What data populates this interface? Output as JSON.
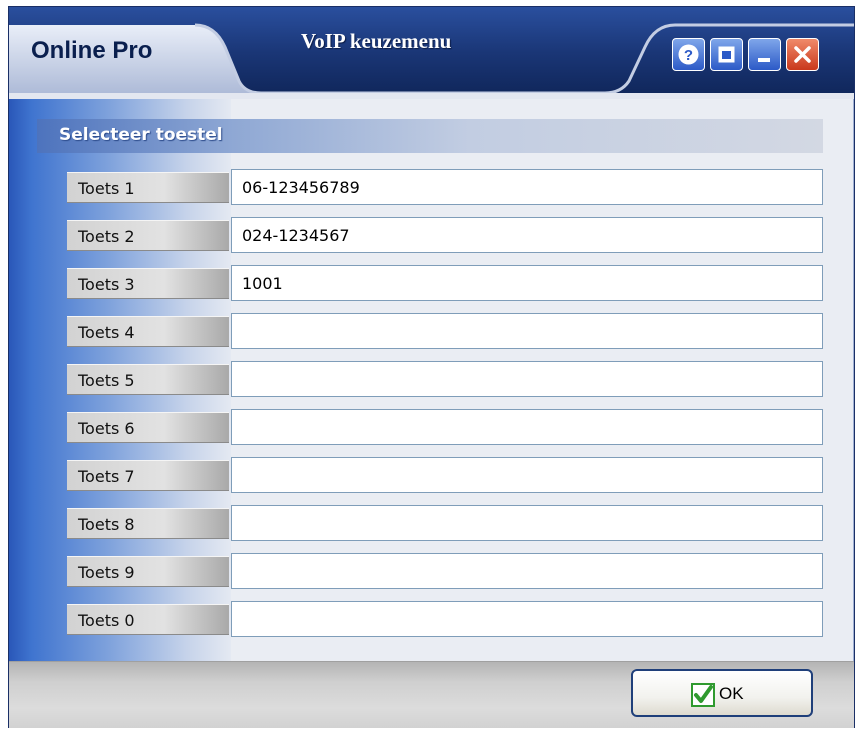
{
  "titlebar": {
    "app_name": "Online Pro",
    "window_title": "VoIP keuzemenu",
    "buttons": {
      "help": "help-icon",
      "restore": "restore-icon",
      "minimize": "minimize-icon",
      "close": "close-icon"
    }
  },
  "section": {
    "title": "Selecteer toestel"
  },
  "rows": [
    {
      "label": "Toets 1",
      "value": "06-123456789"
    },
    {
      "label": "Toets 2",
      "value": "024-1234567"
    },
    {
      "label": "Toets 3",
      "value": "1001"
    },
    {
      "label": "Toets 4",
      "value": ""
    },
    {
      "label": "Toets 5",
      "value": ""
    },
    {
      "label": "Toets 6",
      "value": ""
    },
    {
      "label": "Toets 7",
      "value": ""
    },
    {
      "label": "Toets 8",
      "value": ""
    },
    {
      "label": "Toets 9",
      "value": ""
    },
    {
      "label": "Toets 0",
      "value": ""
    }
  ],
  "footer": {
    "ok_label": "OK",
    "ok_icon": "checkmark-icon"
  },
  "colors": {
    "titlebar": "#1e3f8c",
    "close_button": "#d9472a",
    "check_green": "#2f9a2f"
  }
}
